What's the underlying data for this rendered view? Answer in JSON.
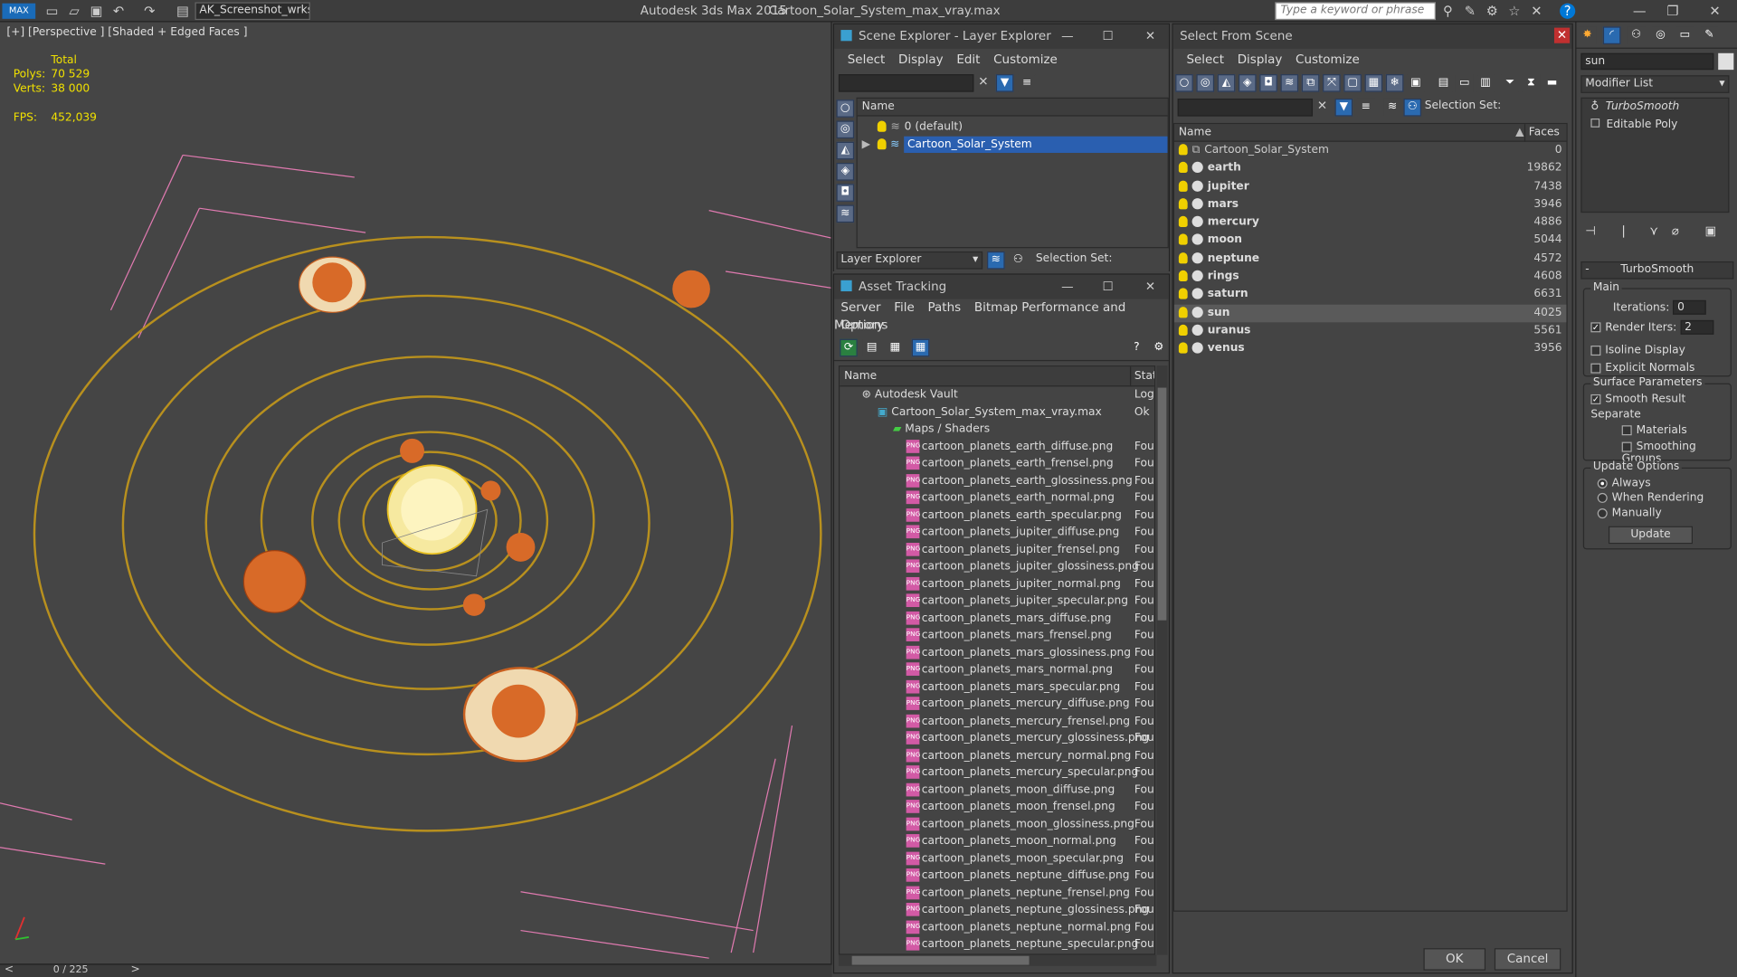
{
  "app": {
    "title": "Autodesk 3ds Max  2015",
    "file": "Cartoon_Solar_System_max_vray.max",
    "workspace": "AK_Screenshot_wrksp",
    "keyword_placeholder": "Type a keyword or phrase"
  },
  "viewport": {
    "label": "[+] [Perspective ] [Shaded + Edged Faces ]",
    "total_label": "Total",
    "polys_label": "Polys:",
    "polys": "70 529",
    "verts_label": "Verts:",
    "verts": "38 000",
    "fps_label": "FPS:",
    "fps": "452,039",
    "timeline": "0 / 225",
    "timeline_prev": "<",
    "timeline_next": ">"
  },
  "scene_explorer": {
    "title": "Scene Explorer - Layer Explorer",
    "menu": [
      "Select",
      "Display",
      "Edit",
      "Customize"
    ],
    "column": "Name",
    "layers": [
      "0 (default)",
      "Cartoon_Solar_System"
    ],
    "footer_dropdown": "Layer Explorer",
    "selection_set": "Selection Set:"
  },
  "asset_tracking": {
    "title": "Asset Tracking",
    "menu": [
      "Server",
      "File",
      "Paths",
      "Bitmap Performance and Memory"
    ],
    "menu2": "Options",
    "col_name": "Name",
    "col_status": "Statu",
    "vault": "Autodesk Vault",
    "vault_status": "Logi",
    "max_file": "Cartoon_Solar_System_max_vray.max",
    "max_status": "Ok",
    "maps": "Maps / Shaders",
    "file_status": "Fou",
    "files": [
      "cartoon_planets_earth_diffuse.png",
      "cartoon_planets_earth_frensel.png",
      "cartoon_planets_earth_glossiness.png",
      "cartoon_planets_earth_normal.png",
      "cartoon_planets_earth_specular.png",
      "cartoon_planets_jupiter_diffuse.png",
      "cartoon_planets_jupiter_frensel.png",
      "cartoon_planets_jupiter_glossiness.png",
      "cartoon_planets_jupiter_normal.png",
      "cartoon_planets_jupiter_specular.png",
      "cartoon_planets_mars_diffuse.png",
      "cartoon_planets_mars_frensel.png",
      "cartoon_planets_mars_glossiness.png",
      "cartoon_planets_mars_normal.png",
      "cartoon_planets_mars_specular.png",
      "cartoon_planets_mercury_diffuse.png",
      "cartoon_planets_mercury_frensel.png",
      "cartoon_planets_mercury_glossiness.png",
      "cartoon_planets_mercury_normal.png",
      "cartoon_planets_mercury_specular.png",
      "cartoon_planets_moon_diffuse.png",
      "cartoon_planets_moon_frensel.png",
      "cartoon_planets_moon_glossiness.png",
      "cartoon_planets_moon_normal.png",
      "cartoon_planets_moon_specular.png",
      "cartoon_planets_neptune_diffuse.png",
      "cartoon_planets_neptune_frensel.png",
      "cartoon_planets_neptune_glossiness.png",
      "cartoon_planets_neptune_normal.png",
      "cartoon_planets_neptune_specular.png"
    ]
  },
  "select_from_scene": {
    "title": "Select From Scene",
    "menu": [
      "Select",
      "Display",
      "Customize"
    ],
    "selection_set": "Selection Set:",
    "col_name": "Name",
    "col_faces": "Faces",
    "objects": [
      {
        "name": "Cartoon_Solar_System",
        "faces": "0"
      },
      {
        "name": "earth",
        "faces": "19862"
      },
      {
        "name": "jupiter",
        "faces": "7438"
      },
      {
        "name": "mars",
        "faces": "3946"
      },
      {
        "name": "mercury",
        "faces": "4886"
      },
      {
        "name": "moon",
        "faces": "5044"
      },
      {
        "name": "neptune",
        "faces": "4572"
      },
      {
        "name": "rings",
        "faces": "4608"
      },
      {
        "name": "saturn",
        "faces": "6631"
      },
      {
        "name": "sun",
        "faces": "4025"
      },
      {
        "name": "uranus",
        "faces": "5561"
      },
      {
        "name": "venus",
        "faces": "3956"
      }
    ],
    "ok": "OK",
    "cancel": "Cancel"
  },
  "modify_panel": {
    "object_name": "sun",
    "modifier_list": "Modifier List",
    "stack": [
      "TurboSmooth",
      "Editable Poly"
    ],
    "rollout_title": "TurboSmooth",
    "main": "Main",
    "iterations_label": "Iterations:",
    "iterations": "0",
    "render_iters_label": "Render Iters:",
    "render_iters": "2",
    "isoline": "Isoline Display",
    "explicit_normals": "Explicit Normals",
    "surface_params": "Surface Parameters",
    "smooth_result": "Smooth Result",
    "separate": "Separate",
    "materials": "Materials",
    "smoothing_groups": "Smoothing Groups",
    "update_options": "Update Options",
    "always": "Always",
    "when_rendering": "When Rendering",
    "manually": "Manually",
    "update": "Update"
  }
}
